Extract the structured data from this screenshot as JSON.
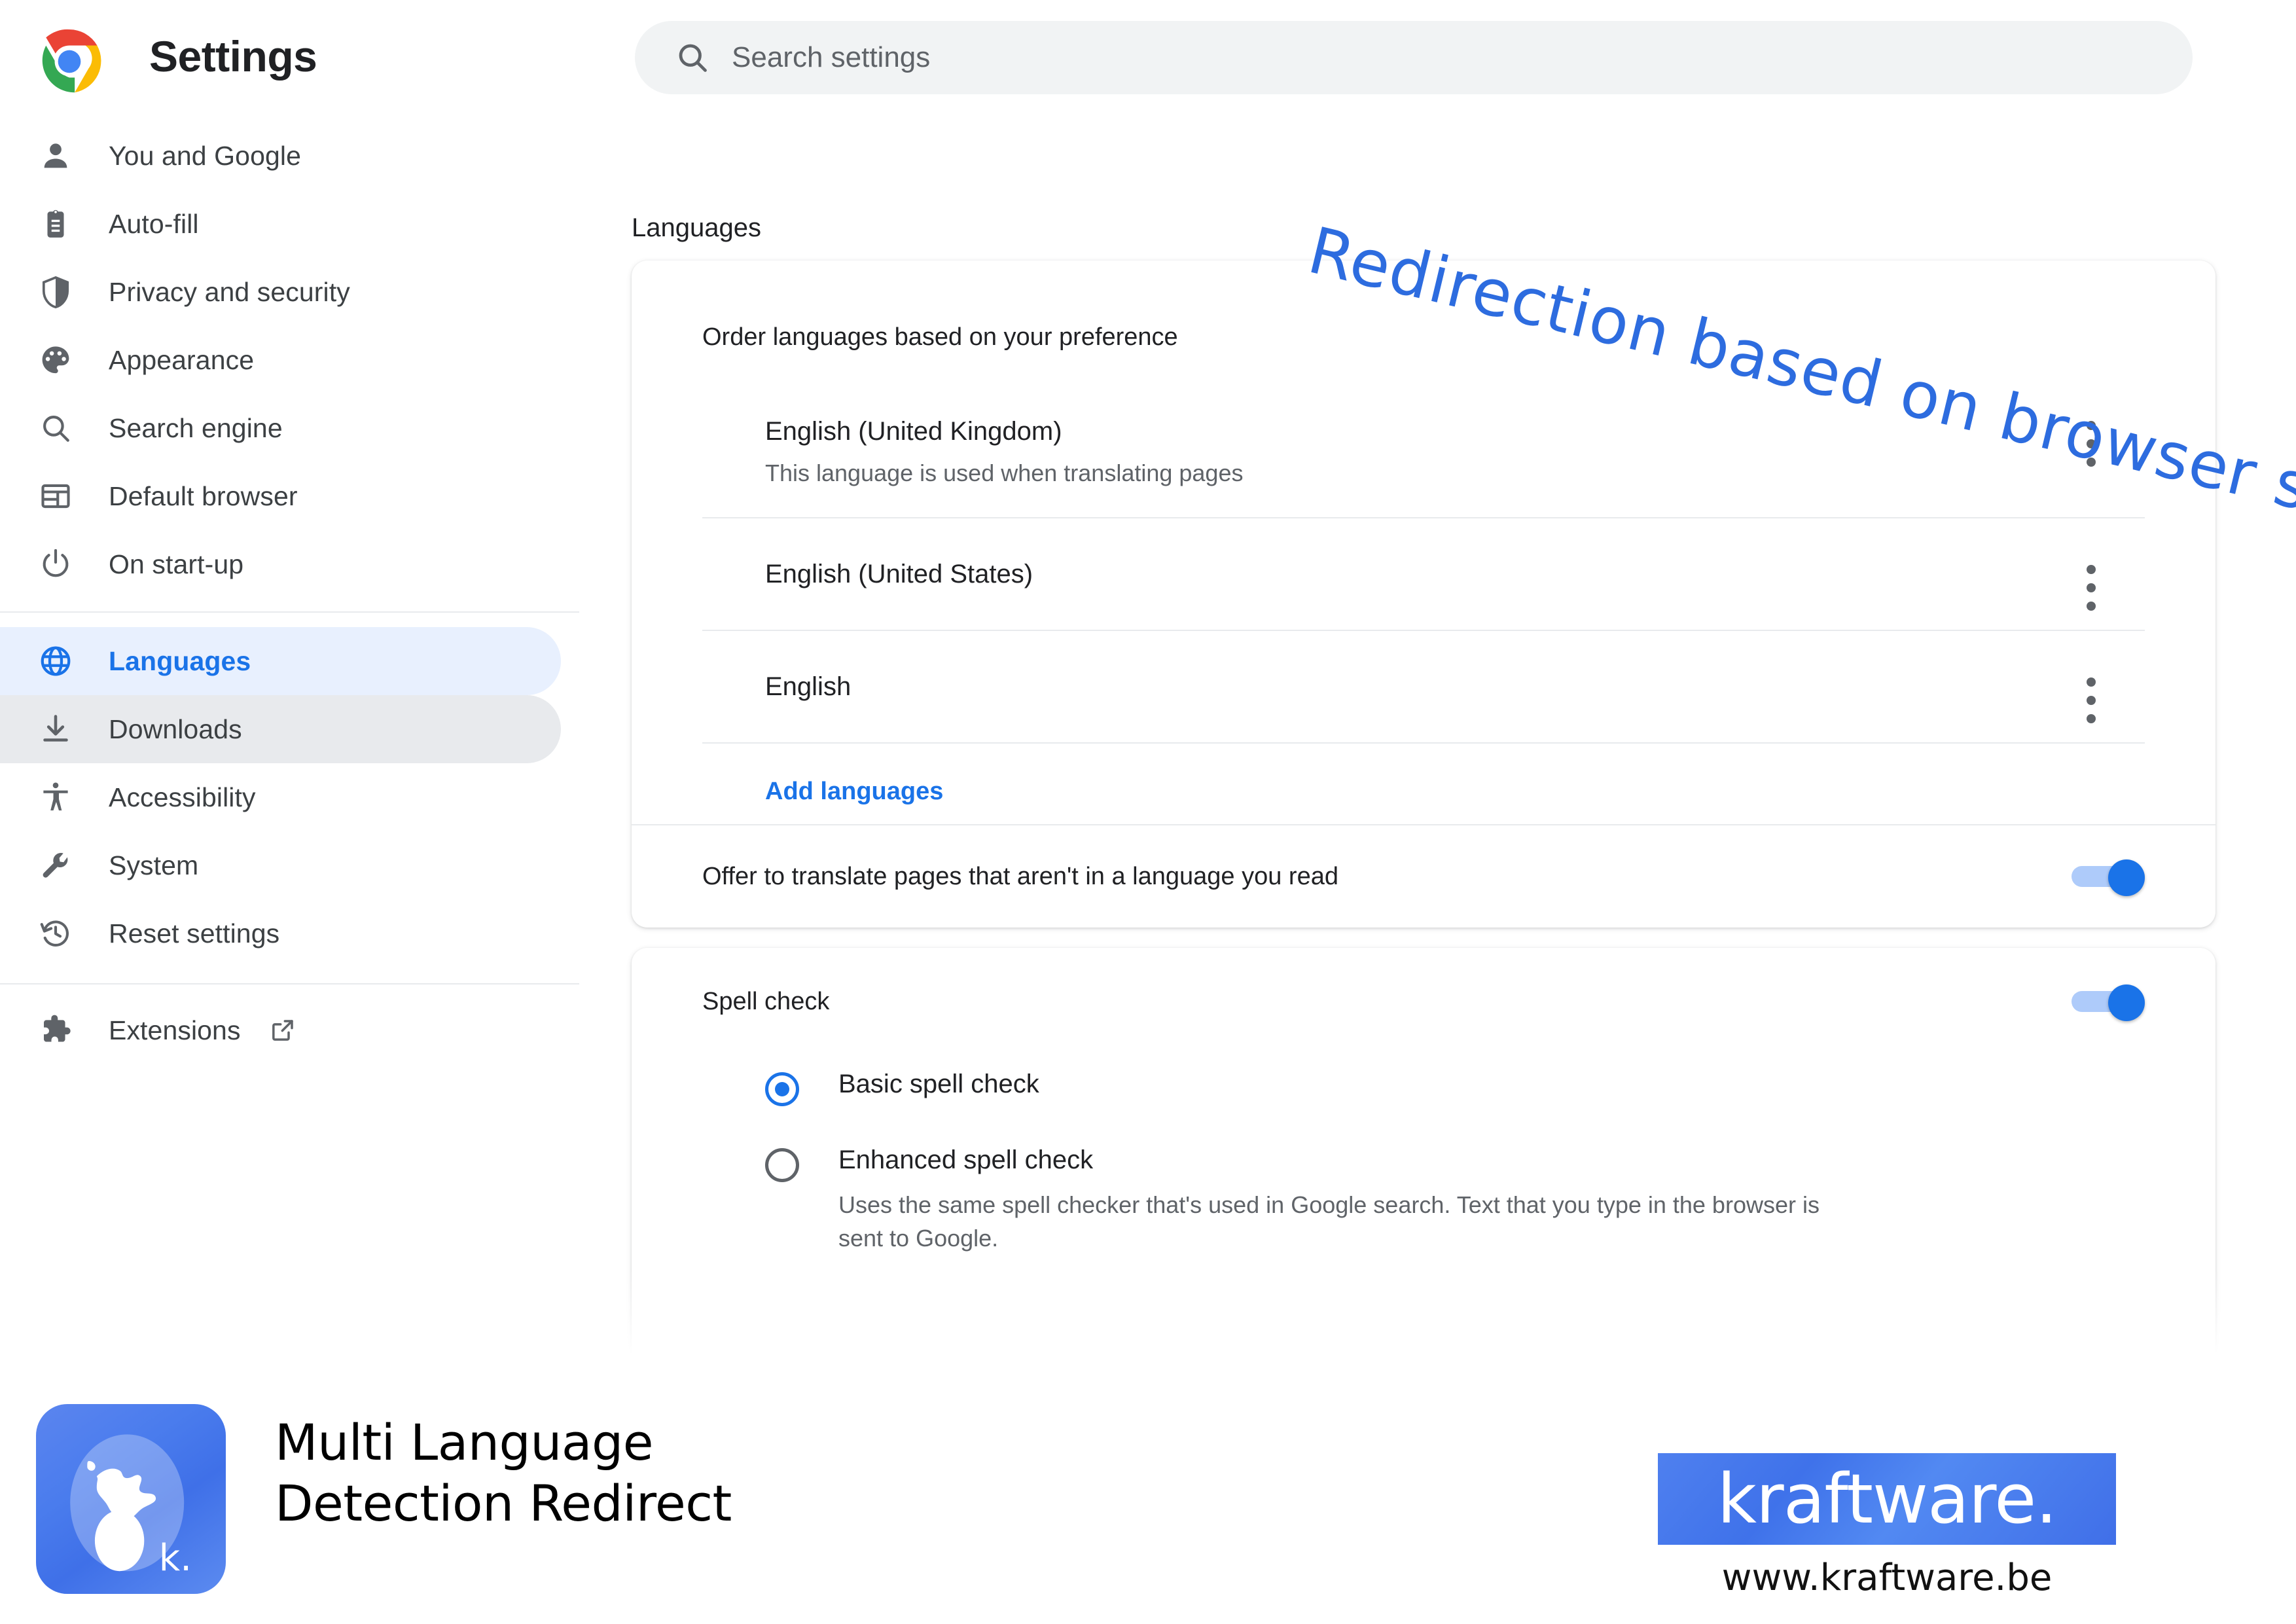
{
  "header": {
    "title": "Settings",
    "logo_icon": "chrome-logo-icon",
    "search": {
      "icon": "search-icon",
      "value": "",
      "placeholder": "Search settings"
    }
  },
  "sidebar": {
    "items": [
      {
        "label": "You and Google",
        "icon": "person-icon",
        "state": "default"
      },
      {
        "label": "Auto-fill",
        "icon": "clipboard-icon",
        "state": "default"
      },
      {
        "label": "Privacy and security",
        "icon": "shield-icon",
        "state": "default"
      },
      {
        "label": "Appearance",
        "icon": "palette-icon",
        "state": "default"
      },
      {
        "label": "Search engine",
        "icon": "search-icon",
        "state": "default"
      },
      {
        "label": "Default browser",
        "icon": "browser-window-icon",
        "state": "default"
      },
      {
        "label": "On start-up",
        "icon": "power-icon",
        "state": "default"
      }
    ],
    "items_group2": [
      {
        "label": "Languages",
        "icon": "globe-icon",
        "state": "selected"
      },
      {
        "label": "Downloads",
        "icon": "download-icon",
        "state": "hovered"
      },
      {
        "label": "Accessibility",
        "icon": "accessibility-icon",
        "state": "default"
      },
      {
        "label": "System",
        "icon": "wrench-icon",
        "state": "default"
      },
      {
        "label": "Reset settings",
        "icon": "history-icon",
        "state": "default"
      }
    ],
    "items_group3": [
      {
        "label": "Extensions",
        "icon": "extension-icon",
        "trailing_icon": "external-link-icon",
        "state": "default"
      }
    ]
  },
  "annotation": {
    "text": "Redirection based on browser settings",
    "color": "#2d6cdf"
  },
  "content": {
    "page_heading": "Languages",
    "languages_card": {
      "order_label": "Order languages based on your preference",
      "languages": [
        {
          "name": "English (United Kingdom)",
          "sub": "This language is used when translating pages",
          "menu_icon": "more-vert-icon"
        },
        {
          "name": "English (United States)",
          "sub": "",
          "menu_icon": "more-vert-icon"
        },
        {
          "name": "English",
          "sub": "",
          "menu_icon": "more-vert-icon"
        }
      ],
      "add_languages_label": "Add languages",
      "translate_row": {
        "label": "Offer to translate pages that aren't in a language you read",
        "toggle_state": "on"
      }
    },
    "spell_check_card": {
      "title": "Spell check",
      "toggle_state": "on",
      "options": [
        {
          "label": "Basic spell check",
          "desc": "",
          "selected": true
        },
        {
          "label": "Enhanced spell check",
          "desc": "Uses the same spell checker that's used in Google search. Text that you type in the browser is sent to Google.",
          "selected": false
        }
      ]
    }
  },
  "footer": {
    "app_icon": "globe-app-icon",
    "app_icon_mark": "k.",
    "app_title_line1": "Multi Language",
    "app_title_line2": "Detection Redirect",
    "brand_badge": "kraftware.",
    "brand_url": "www.kraftware.be"
  },
  "colors": {
    "accent_blue": "#1a73e8",
    "selected_bg": "#e8f0fe",
    "hover_bg": "#e8eaed",
    "text_primary": "#202124",
    "text_secondary": "#5f6368",
    "divider": "#e8eaed",
    "brand_blue": "#4a7ced"
  }
}
